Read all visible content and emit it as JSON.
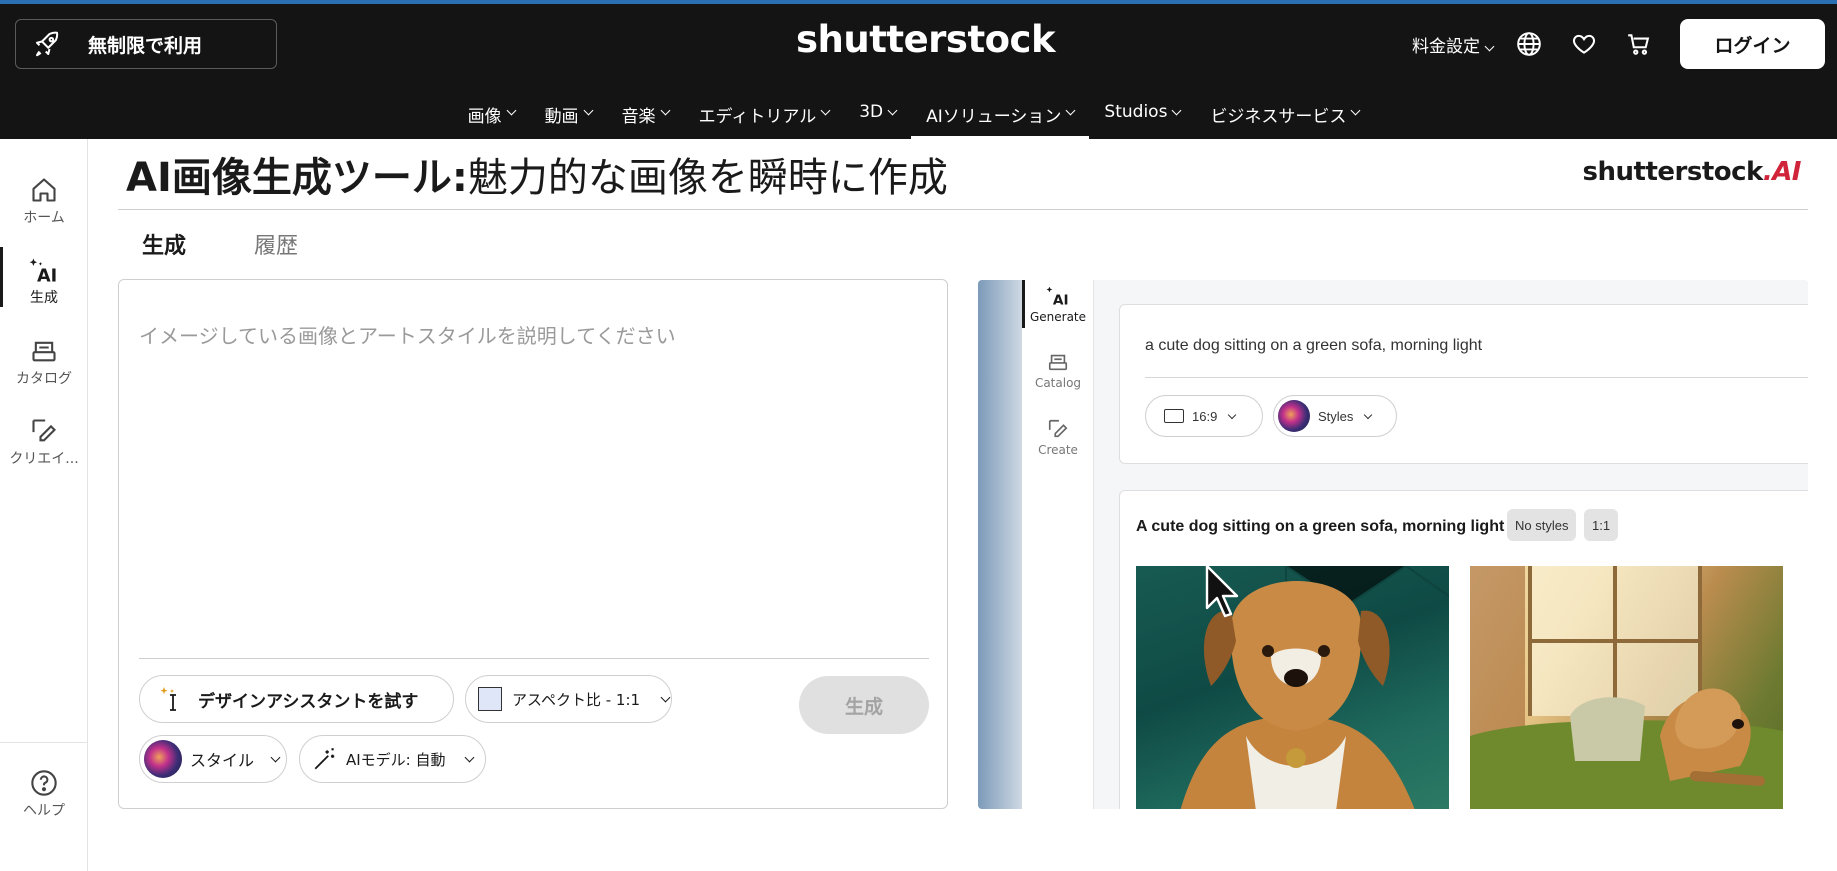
{
  "header": {
    "unlimited_label": "無制限で利用",
    "brand": "shutterstock",
    "pricing_label": "料金設定",
    "login_label": "ログイン",
    "icons": [
      "globe-icon",
      "heart-icon",
      "cart-icon"
    ]
  },
  "nav": {
    "items": [
      {
        "label": "画像"
      },
      {
        "label": "動画"
      },
      {
        "label": "音楽"
      },
      {
        "label": "エディトリアル"
      },
      {
        "label": "3D"
      },
      {
        "label": "AIソリューション"
      },
      {
        "label": "Studios"
      },
      {
        "label": "ビジネスサービス"
      }
    ],
    "active_index": 5
  },
  "sidebar": {
    "items": [
      {
        "label": "ホーム",
        "icon": "home-icon"
      },
      {
        "label": "生成",
        "icon": "ai-sparkle-icon"
      },
      {
        "label": "カタログ",
        "icon": "catalog-icon"
      },
      {
        "label": "クリエイ...",
        "icon": "edit-icon"
      }
    ],
    "help_label": "ヘルプ"
  },
  "page": {
    "title_bold": "AI画像生成ツール:",
    "title_rest": "魅力的な画像を瞬時に作成",
    "ai_logo": "shutterstock",
    "ai_logo_suffix": ".AI",
    "tabs": [
      {
        "label": "生成"
      },
      {
        "label": "履歴"
      }
    ]
  },
  "prompt": {
    "placeholder": "イメージしている画像とアートスタイルを説明してください",
    "value": "",
    "assist_label": "デザインアシスタントを試す",
    "aspect_label": "アスペクト比 - 1:1",
    "style_label": "スタイル",
    "model_label": "AIモデル: 自動",
    "generate_label": "生成"
  },
  "preview": {
    "side": [
      {
        "label": "Generate",
        "icon": "ai-sparkle-icon"
      },
      {
        "label": "Catalog",
        "icon": "catalog-icon"
      },
      {
        "label": "Create",
        "icon": "edit-icon"
      }
    ],
    "prompt_text": "a cute dog sitting on a green sofa, morning light",
    "ratio_label": "16:9",
    "styles_label": "Styles",
    "result_title": "A cute dog sitting on a green sofa, morning light",
    "tag_styles": "No styles",
    "tag_ratio": "1:1"
  },
  "colors": {
    "header_bg": "#141414",
    "top_accent": "#2b6fb3",
    "ai_accent": "#d0243a",
    "generate_disabled_bg": "#e0e0e0"
  }
}
